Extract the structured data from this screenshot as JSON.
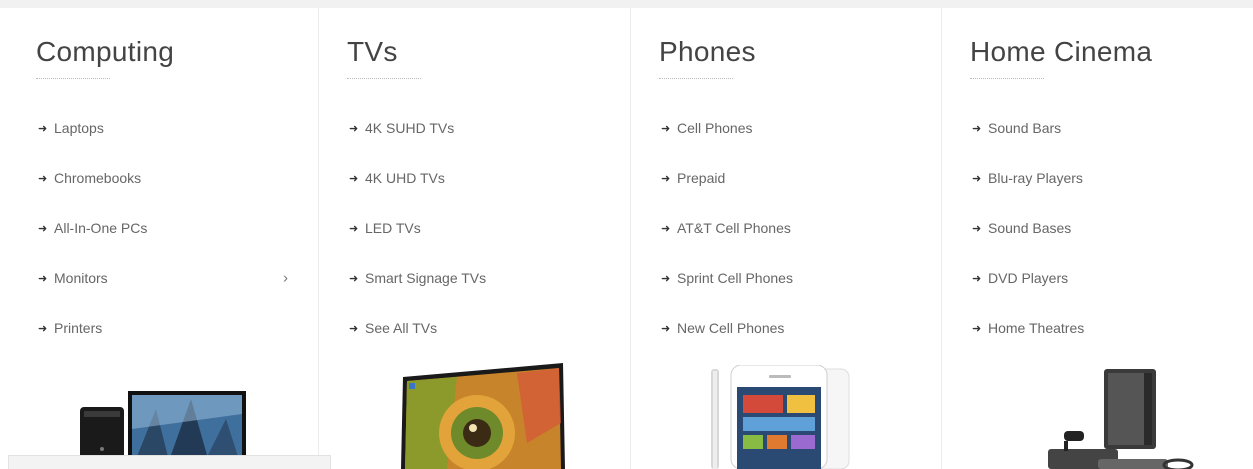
{
  "columns": [
    {
      "title": "Computing",
      "items": [
        "Laptops",
        "Chromebooks",
        "All-In-One PCs",
        "Monitors",
        "Printers"
      ]
    },
    {
      "title": "TVs",
      "items": [
        "4K SUHD TVs",
        "4K UHD TVs",
        "LED TVs",
        "Smart Signage TVs",
        "See All TVs"
      ]
    },
    {
      "title": "Phones",
      "items": [
        "Cell Phones",
        "Prepaid",
        "AT&T Cell Phones",
        "Sprint Cell Phones",
        "New Cell Phones"
      ]
    },
    {
      "title": "Home Cinema",
      "items": [
        "Sound Bars",
        "Blu-ray Players",
        "Sound Bases",
        "DVD Players",
        "Home Theatres"
      ]
    }
  ],
  "icons": {
    "bullet": "arrow-right-icon",
    "submenu": "chevron-right-icon"
  },
  "colors": {
    "accent": "#444444",
    "text": "#666666",
    "divider": "#ececec"
  }
}
